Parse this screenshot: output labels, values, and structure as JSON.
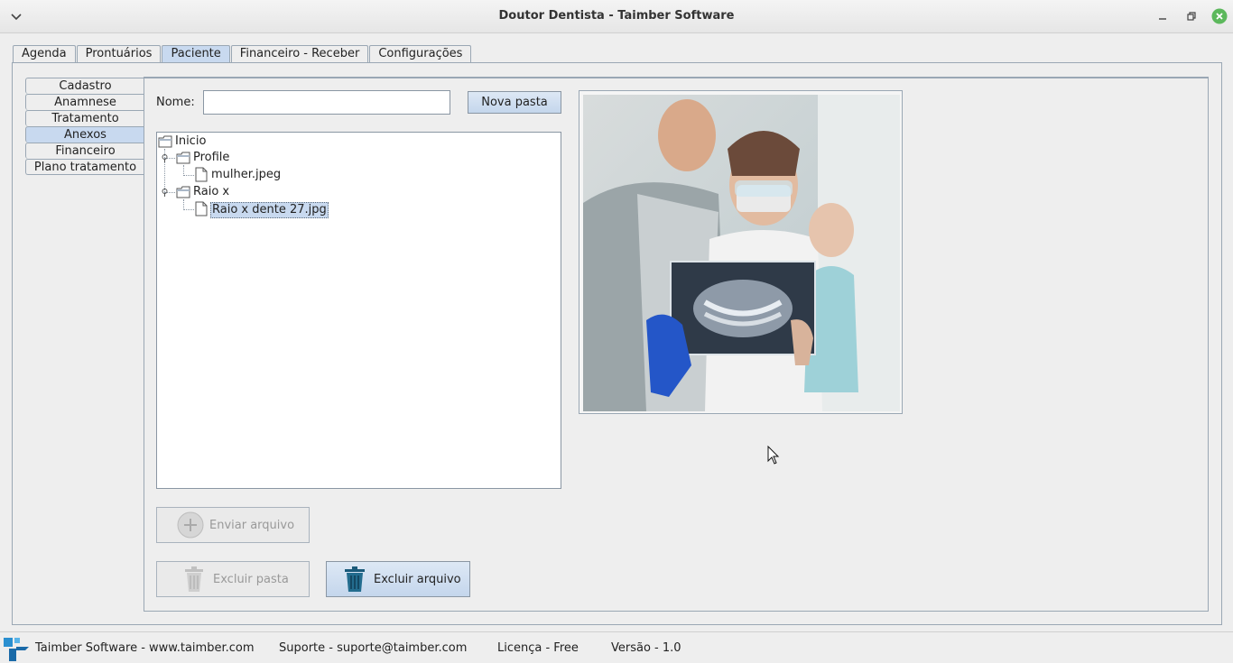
{
  "window": {
    "title": "Doutor Dentista - Taimber Software"
  },
  "top_tabs": [
    "Agenda",
    "Prontuários",
    "Paciente",
    "Financeiro - Receber",
    "Configurações"
  ],
  "top_tabs_active": "Paciente",
  "side_tabs": [
    "Cadastro",
    "Anamnese",
    "Tratamento",
    "Anexos",
    "Financeiro",
    "Plano tratamento"
  ],
  "side_tabs_active": "Anexos",
  "form": {
    "name_label": "Nome:",
    "name_value": "",
    "new_folder_label": "Nova pasta"
  },
  "tree": {
    "root": "Inicio",
    "folders": [
      {
        "name": "Profile",
        "files": [
          "mulher.jpeg"
        ]
      },
      {
        "name": "Raio x",
        "files": [
          "Raio x dente 27.jpg"
        ]
      }
    ],
    "selected": "Raio x dente 27.jpg"
  },
  "actions": {
    "send_file": "Enviar arquivo",
    "delete_folder": "Excluir pasta",
    "delete_file": "Excluir arquivo"
  },
  "status": {
    "company": "Taimber Software - www.taimber.com",
    "support": "Suporte - suporte@taimber.com",
    "license": "Licença - Free",
    "version": "Versão - 1.0"
  },
  "colors": {
    "accent_tab": "#c8d9ef",
    "close_button": "#5cb85c",
    "trash_icon": "#1a5a7a"
  }
}
